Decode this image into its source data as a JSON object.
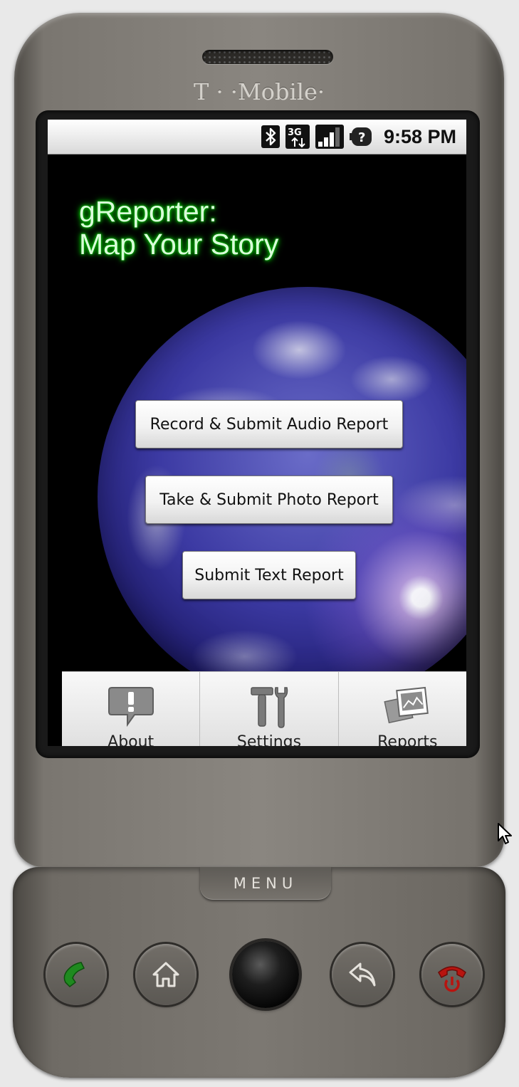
{
  "device": {
    "carrier": "T · ·Mobile·",
    "menu_key_label": "MENU"
  },
  "status_bar": {
    "time": "9:58 PM",
    "icons": [
      "bluetooth-icon",
      "3g-data-icon",
      "signal-strength-icon",
      "battery-unknown-icon"
    ]
  },
  "app": {
    "title_line1": "gReporter:",
    "title_line2": "Map Your Story"
  },
  "actions": {
    "audio": "Record & Submit Audio Report",
    "photo": "Take & Submit Photo Report",
    "text": "Submit Text Report"
  },
  "options_menu": {
    "items": [
      {
        "label": "About",
        "icon": "about-speech-bubble-icon"
      },
      {
        "label": "Settings",
        "icon": "settings-tools-icon"
      },
      {
        "label": "Reports",
        "icon": "reports-gallery-icon"
      }
    ]
  },
  "hardware_buttons": [
    "call-icon",
    "home-icon",
    "trackball",
    "back-icon",
    "end-call-icon"
  ],
  "colors": {
    "title_glow": "#00b000",
    "call_green": "#1f8a1f",
    "end_red": "#b8140f"
  }
}
